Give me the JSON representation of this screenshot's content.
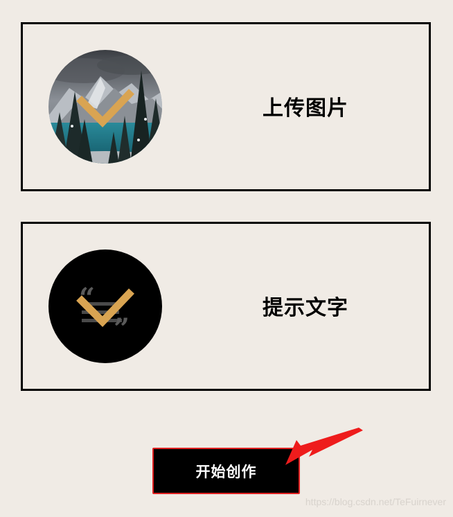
{
  "cards": {
    "upload": {
      "label": "上传图片",
      "icon": "landscape-photo-checked-icon"
    },
    "prompt": {
      "label": "提示文字",
      "icon": "quote-text-checked-icon"
    }
  },
  "start_button": {
    "label": "开始创作"
  },
  "annotation": {
    "icon": "red-arrow-pointer-icon"
  },
  "watermark": "https://blog.csdn.net/TeFuirnever",
  "colors": {
    "background": "#f0ebe5",
    "border": "#000000",
    "check": "#d9a452",
    "button_bg": "#000000",
    "button_border": "#e02020",
    "arrow": "#ee1c1c"
  }
}
